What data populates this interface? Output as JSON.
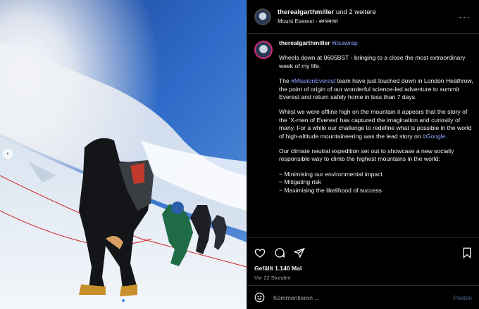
{
  "header": {
    "username": "therealgarthmiller",
    "collaborators": "und 2 weitere",
    "location": "Mount Everest - सगरमाथा",
    "more_icon": "more-horizontal-icon"
  },
  "caption": {
    "username": "therealgarthmiller",
    "hashtag": "#itsawrap",
    "p1": "Wheels down at 0605BST - bringing to a close the most extraordinary week of my life.",
    "p2_tag": "#MissionEverest",
    "p2_rest": " team have just touched down in London Heathrow, the point of origin of our wonderful science-led adventure to summit Everest and return safely home in less than 7 days.",
    "p3_text": "Whilst we were offline high on the mountain it appears that the story of the ‘X-men of Everest’ has captured the imagination and curiosity of many. For a while our challenge to redefine what is possible in the world of high-altitude mountaineering was the lead story on ",
    "p3_tag": "#Google",
    "p3_end": ".",
    "p4": "Our climate neutral expedition set out to showcase a new socially responsible way to climb the highest mountains in the world:",
    "bullets": [
      "~ Minimising our environmental impact",
      "~ Mitigating risk",
      "~ Maximising the likelihood of success"
    ]
  },
  "engagement": {
    "likes": "Gefällt 1.140 Mal",
    "time": "Vor 22 Stunden"
  },
  "comment": {
    "placeholder": "Kommentieren ...",
    "post_label": "Posten"
  },
  "carousel": {
    "total": 5,
    "active": 3
  },
  "colors": {
    "hashtag": "#8ea3ff",
    "dot_active": "#3b8eff",
    "sky": "#1c4fa0"
  }
}
